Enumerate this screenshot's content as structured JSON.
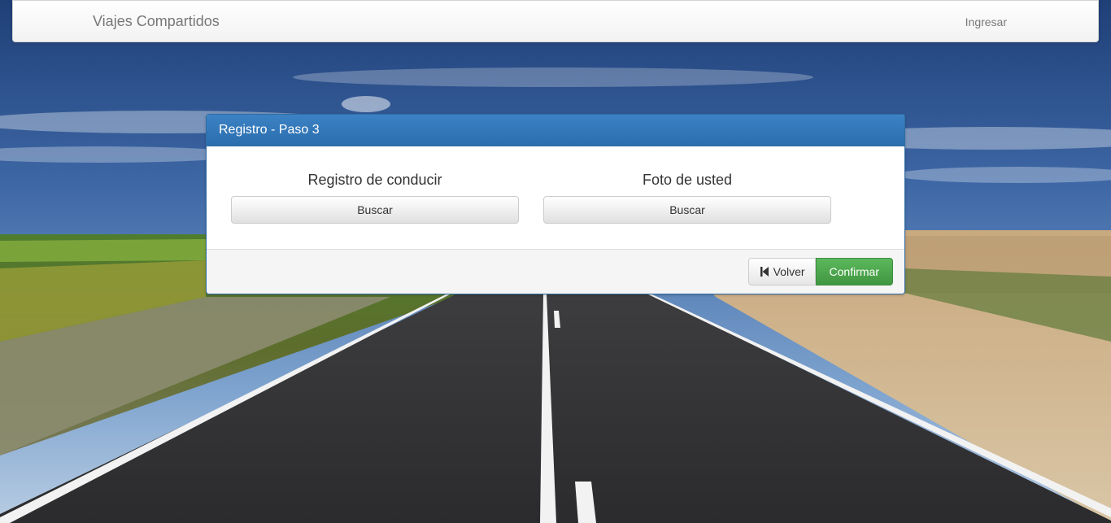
{
  "navbar": {
    "brand": "Viajes Compartidos",
    "login_link": "Ingresar"
  },
  "panel": {
    "title": "Registro - Paso 3",
    "fields": [
      {
        "label": "Registro de conducir",
        "button": "Buscar"
      },
      {
        "label": "Foto de usted",
        "button": "Buscar"
      }
    ],
    "footer": {
      "back_label": "Volver",
      "back_icon": "step-backward-icon",
      "confirm_label": "Confirmar"
    }
  },
  "colors": {
    "panel_heading": "#337ab7",
    "confirm_button": "#5cb85c"
  }
}
